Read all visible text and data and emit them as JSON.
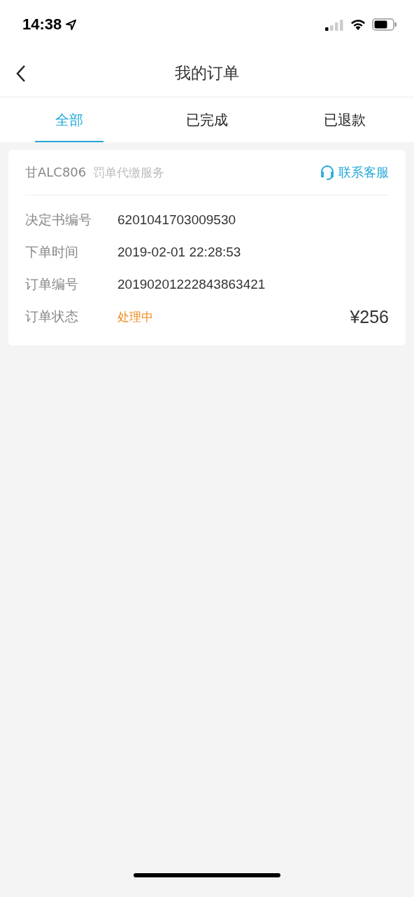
{
  "status_bar": {
    "time": "14:38"
  },
  "nav": {
    "title": "我的订单"
  },
  "tabs": [
    {
      "label": "全部",
      "selected": true
    },
    {
      "label": "已完成",
      "selected": false
    },
    {
      "label": "已退款",
      "selected": false
    }
  ],
  "orders": [
    {
      "plate": "甘ALC806",
      "service": "罚单代缴服务",
      "contact": "联系客服",
      "fields": [
        {
          "label": "决定书编号",
          "value": "6201041703009530"
        },
        {
          "label": "下单时间",
          "value": "2019-02-01 22:28:53"
        },
        {
          "label": "订单编号",
          "value": "20190201222843863421"
        }
      ],
      "status": {
        "label": "订单状态",
        "value": "处理中"
      },
      "amount": "¥256"
    }
  ]
}
